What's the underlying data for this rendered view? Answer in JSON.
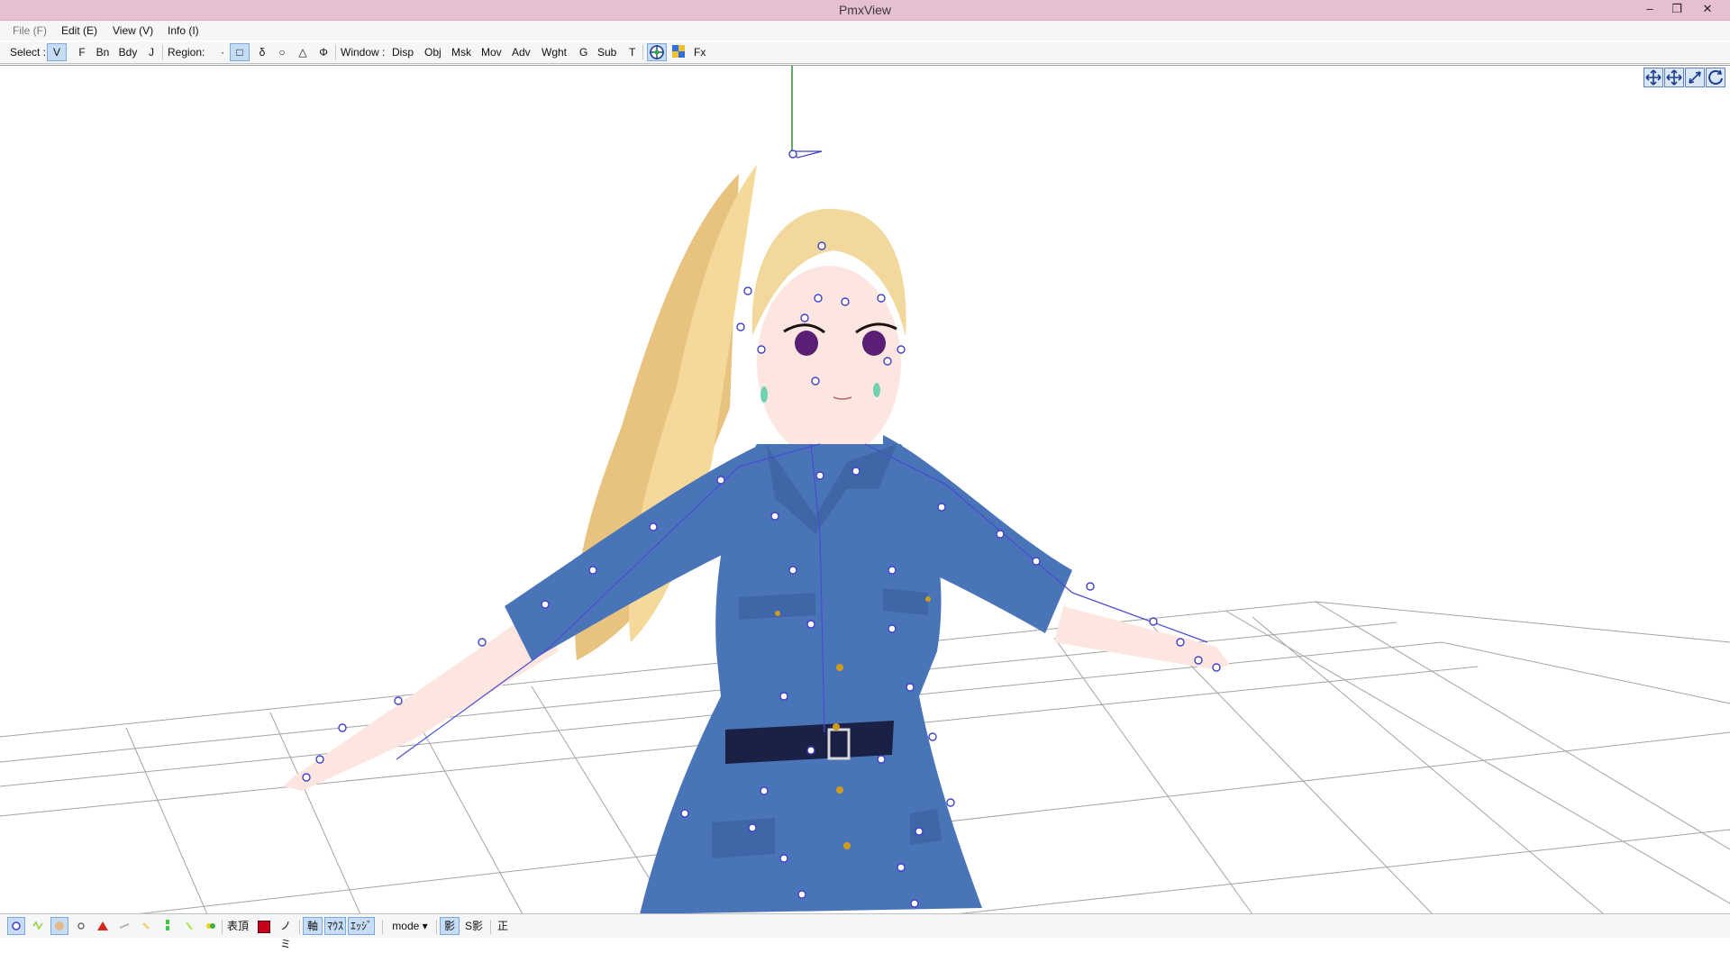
{
  "window": {
    "title": "PmxView",
    "minimize_icon": "minimize-icon",
    "restore_icon": "restore-icon",
    "close_icon": "close-icon",
    "minimize_glyph": "–",
    "restore_glyph": "❐",
    "close_glyph": "✕"
  },
  "menu": [
    {
      "label": "File (F)",
      "enabled": false
    },
    {
      "label": "Edit (E)",
      "enabled": true
    },
    {
      "label": "View (V)",
      "enabled": true
    },
    {
      "label": "Info (I)",
      "enabled": true
    }
  ],
  "toolbar": {
    "select_label": "Select :",
    "select_items": [
      {
        "label": "V",
        "active": true
      },
      {
        "label": "F",
        "active": false
      },
      {
        "label": "Bn",
        "active": false
      },
      {
        "label": "Bdy",
        "active": false
      },
      {
        "label": "J",
        "active": false
      }
    ],
    "region_label": "Region:",
    "region_items": [
      {
        "label": "·",
        "active": false
      },
      {
        "label": "□",
        "active": true
      },
      {
        "label": "δ",
        "active": false
      },
      {
        "label": "○",
        "active": false
      },
      {
        "label": "△",
        "active": false
      },
      {
        "label": "Φ",
        "active": false
      }
    ],
    "window_label": "Window :",
    "window_items": [
      "Disp",
      "Obj",
      "Msk",
      "Mov",
      "Adv",
      "Wght",
      "G",
      "Sub",
      "T"
    ],
    "fx_label": "Fx",
    "icons": [
      "target-icon",
      "grid-icon"
    ]
  },
  "view_controls": [
    "move-xy-icon",
    "move-xz-icon",
    "zoom-icon",
    "rotate-icon"
  ],
  "statusbar": {
    "icon_buttons": [
      "vertex-dot-icon",
      "morph-icon",
      "material-icon",
      "point-icon",
      "triangle-icon",
      "weight-icon",
      "bone-icon",
      "ik-icon",
      "physics-icon"
    ],
    "items": [
      {
        "label": "表頂",
        "active": false
      },
      {
        "label": "ノミ",
        "active": false
      },
      {
        "label": "軸",
        "active": true
      },
      {
        "label": "ﾏｳｽ",
        "active": true
      },
      {
        "label": "ｴｯｼﾞ",
        "active": true
      },
      {
        "label": "mode",
        "active": false
      },
      {
        "label": "影",
        "active": true
      },
      {
        "label": "S影",
        "active": false
      },
      {
        "label": "正",
        "active": false
      }
    ],
    "colors": {
      "material_swatch": "#c8001e",
      "accent": "#c7dcf5"
    }
  },
  "viewport": {
    "description_colors": {
      "grid": "#9a9a9a",
      "bone": "#3d3dcc",
      "dress": "#4a74b8",
      "hair": "#f0d79a",
      "skin": "#fde6df",
      "belt": "#1a2145"
    }
  }
}
